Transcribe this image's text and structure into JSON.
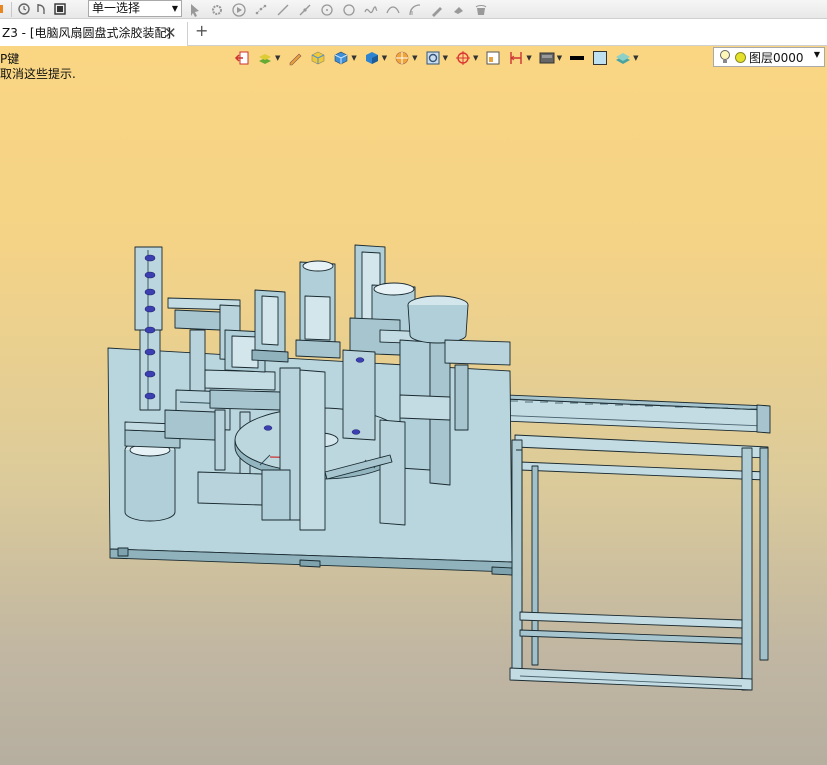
{
  "toolbar": {
    "select_mode": "单一选择"
  },
  "tabs": [
    {
      "label": "Z3 - [电脑风扇圆盘式涂胶装配]"
    }
  ],
  "hints": {
    "line1": "P键",
    "line2": "取消这些提示."
  },
  "view_toolbar": {
    "layer_label": "图层0000"
  },
  "colors": {
    "viewport_top": "#fad683",
    "viewport_bottom": "#b6ae9f",
    "model_fill": "#b8d3dc",
    "model_edge": "#1a2a30"
  }
}
